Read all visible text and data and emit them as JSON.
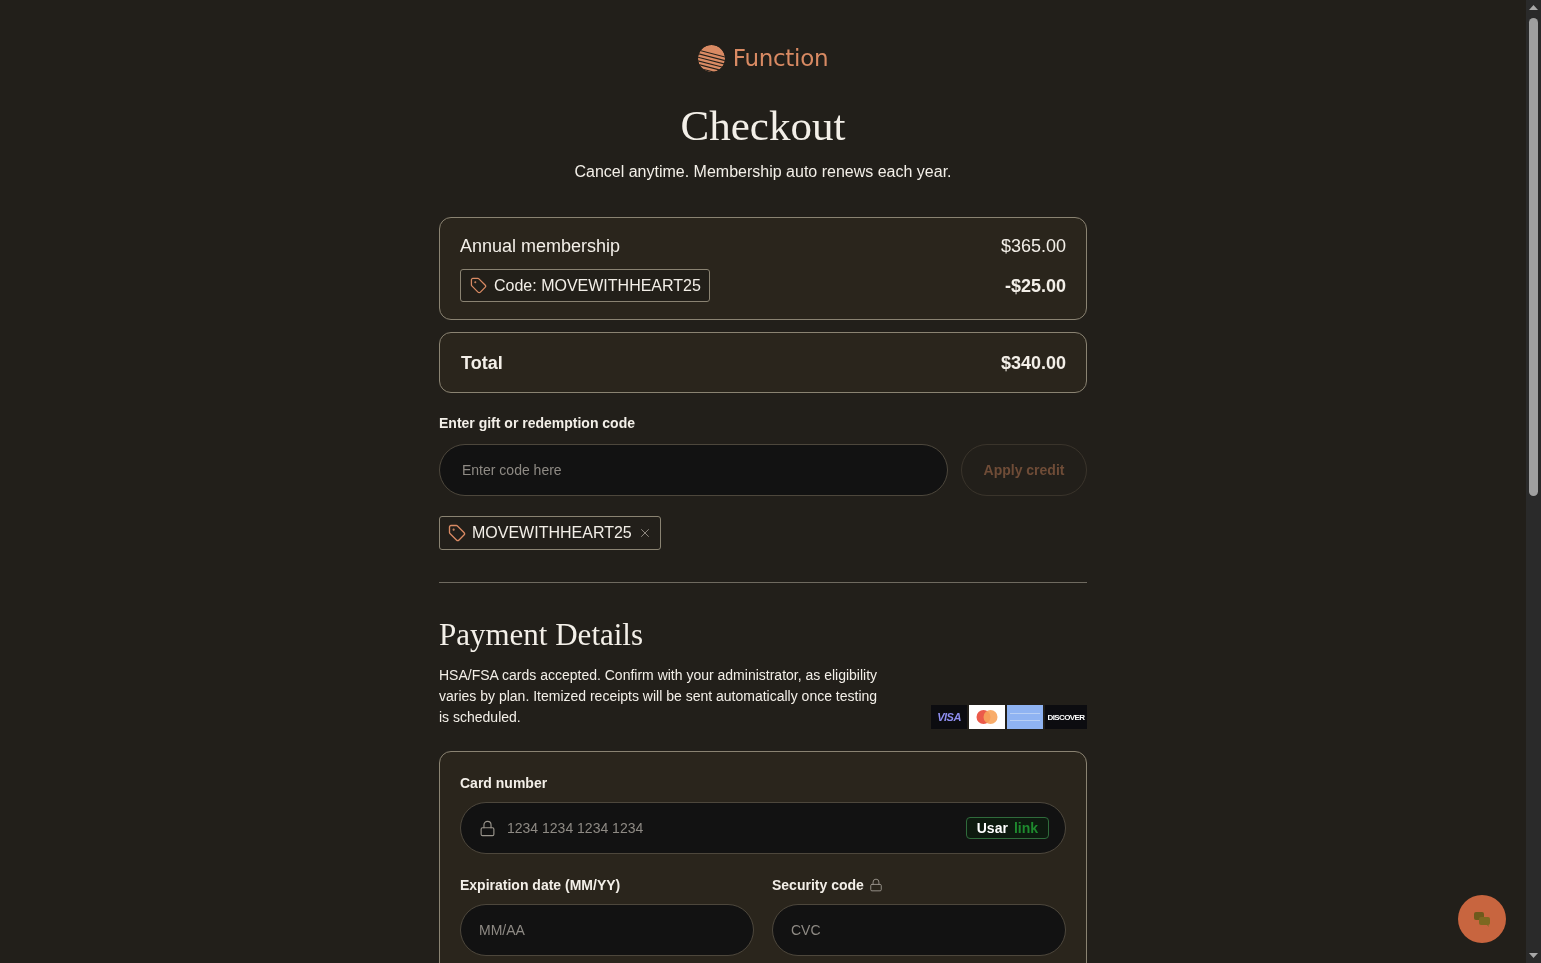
{
  "brand": {
    "name": "Function"
  },
  "title": "Checkout",
  "subtitle": "Cancel anytime. Membership auto renews each year.",
  "summary": {
    "item": {
      "label": "Annual membership",
      "price": "$365.00"
    },
    "discount": {
      "code_label": "Code: MOVEWITHHEART25",
      "amount": "-$25.00"
    }
  },
  "total": {
    "label": "Total",
    "amount": "$340.00"
  },
  "redeem": {
    "label": "Enter gift or redemption code",
    "placeholder": "Enter code here",
    "button": {
      "label": "Apply credit",
      "disabled": true
    },
    "applied_codes": [
      {
        "code": "MOVEWITHHEART25"
      }
    ]
  },
  "payment": {
    "title": "Payment Details",
    "note": "HSA/FSA cards accepted. Confirm with your administrator, as eligibility varies by plan. Itemized receipts will be sent automatically once testing is scheduled.",
    "card_brands": [
      {
        "kind": "visa",
        "label": "VISA"
      },
      {
        "kind": "mastercard"
      },
      {
        "kind": "amex"
      },
      {
        "kind": "discover",
        "label": "DISCOVER"
      }
    ],
    "card_number": {
      "label": "Card number",
      "placeholder": "1234 1234 1234 1234",
      "link_button": {
        "prefix": "Usar",
        "brand": "link"
      }
    },
    "expiry": {
      "label": "Expiration date (MM/YY)",
      "placeholder": "MM/AA"
    },
    "security_code": {
      "label": "Security code",
      "placeholder": "CVC"
    }
  }
}
